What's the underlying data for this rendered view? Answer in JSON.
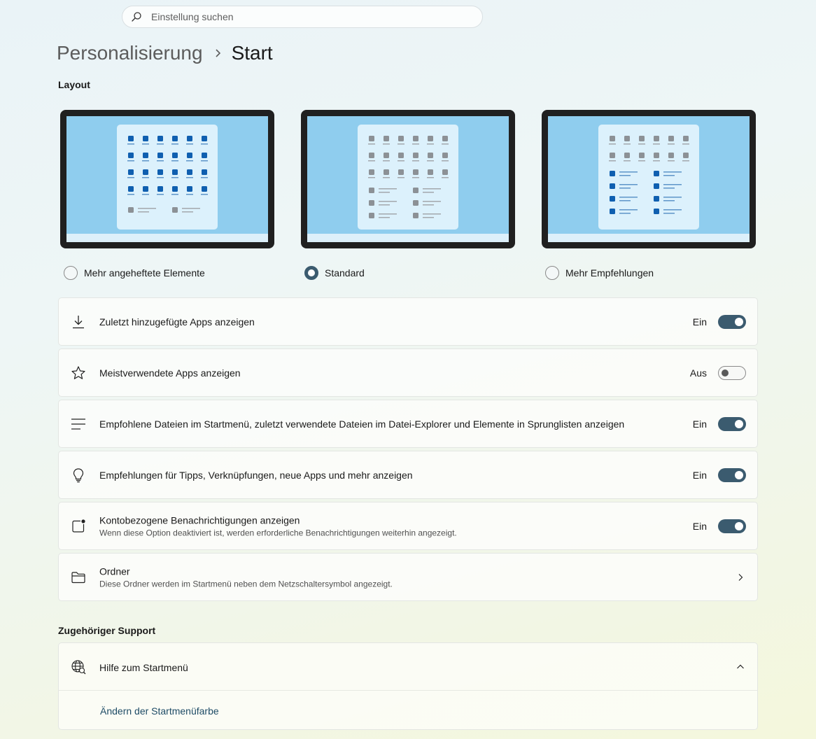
{
  "search": {
    "placeholder": "Einstellung suchen"
  },
  "breadcrumb": {
    "parent": "Personalisierung",
    "current": "Start"
  },
  "layout": {
    "section_title": "Layout",
    "options": [
      {
        "label": "Mehr angeheftete Elemente",
        "selected": false
      },
      {
        "label": "Standard",
        "selected": true
      },
      {
        "label": "Mehr Empfehlungen",
        "selected": false
      }
    ]
  },
  "settings": [
    {
      "title": "Zuletzt hinzugefügte Apps anzeigen",
      "state": "Ein",
      "on": true,
      "icon": "download-icon"
    },
    {
      "title": "Meistverwendete Apps anzeigen",
      "state": "Aus",
      "on": false,
      "icon": "star-icon"
    },
    {
      "title": "Empfohlene Dateien im Startmenü, zuletzt verwendete Dateien im Datei-Explorer und Elemente in Sprunglisten anzeigen",
      "state": "Ein",
      "on": true,
      "icon": "list-icon"
    },
    {
      "title": "Empfehlungen für Tipps, Verknüpfungen, neue Apps und mehr anzeigen",
      "state": "Ein",
      "on": true,
      "icon": "lightbulb-icon"
    },
    {
      "title": "Kontobezogene Benachrichtigungen anzeigen",
      "desc": "Wenn diese Option deaktiviert ist, werden erforderliche Benachrichtigungen weiterhin angezeigt.",
      "state": "Ein",
      "on": true,
      "icon": "notification-icon"
    },
    {
      "title": "Ordner",
      "desc": "Diese Ordner werden im Startmenü neben dem Netzschaltersymbol angezeigt.",
      "icon": "folder-icon"
    }
  ],
  "support": {
    "section_title": "Zugehöriger Support",
    "help_title": "Hilfe zum Startmenü",
    "link": "Ändern der Startmenüfarbe"
  },
  "colors": {
    "accent": "#3b5b6f",
    "tile_blue": "#0f5fb0",
    "tile_gray": "#8c9196"
  }
}
